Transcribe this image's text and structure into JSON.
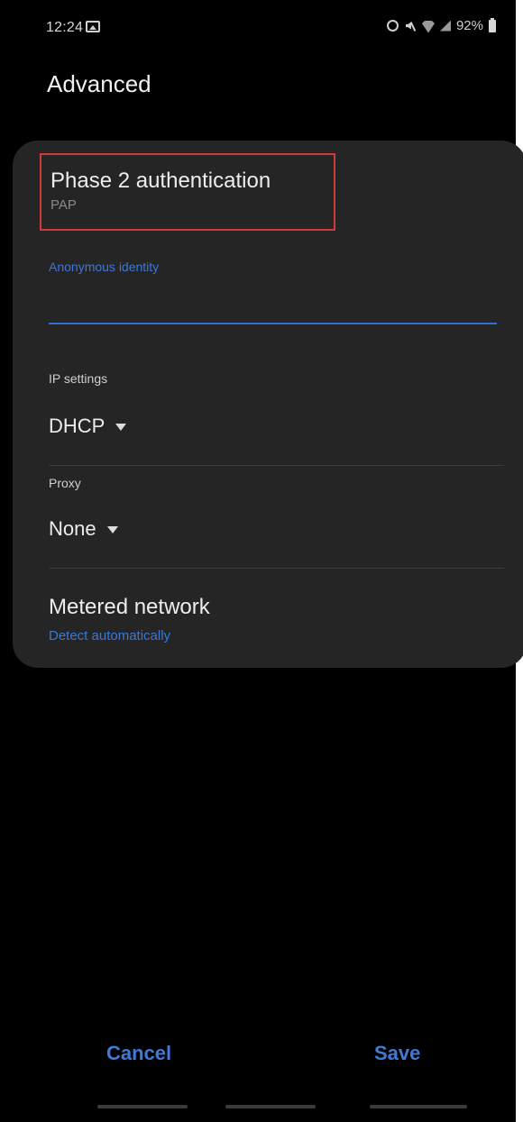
{
  "status_bar": {
    "time": "12:24",
    "battery": "92%",
    "icons": [
      "gallery-icon",
      "alarm-icon",
      "mute-icon",
      "wifi-icon",
      "signal-icon",
      "battery-icon"
    ]
  },
  "page": {
    "title": "Advanced"
  },
  "phase2": {
    "title": "Phase 2 authentication",
    "value": "PAP"
  },
  "anonymous_identity": {
    "label": "Anonymous identity",
    "value": ""
  },
  "ip_settings": {
    "label": "IP settings",
    "value": "DHCP"
  },
  "proxy": {
    "label": "Proxy",
    "value": "None"
  },
  "metered_network": {
    "title": "Metered network",
    "value": "Detect automatically"
  },
  "actions": {
    "cancel": "Cancel",
    "save": "Save"
  },
  "colors": {
    "accent": "#3b78d8",
    "highlight_border": "#d23a3a",
    "card_bg": "#252525",
    "background": "#000000"
  }
}
